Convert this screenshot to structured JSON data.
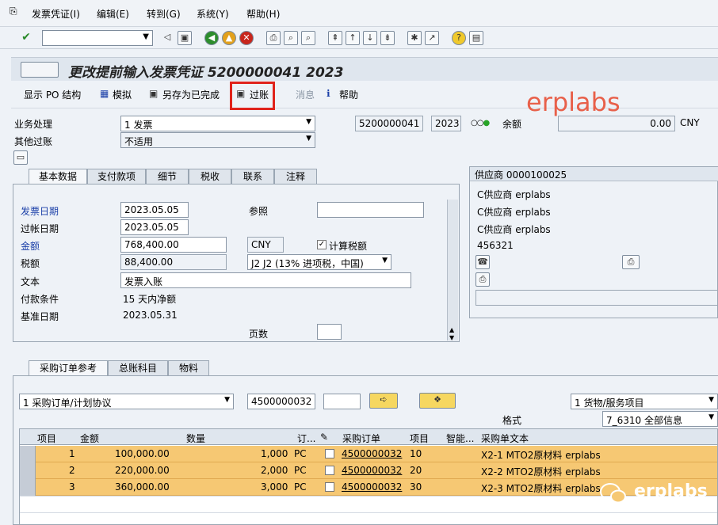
{
  "menu": {
    "items": [
      "发票凭证(I)",
      "编辑(E)",
      "转到(G)",
      "系统(Y)",
      "帮助(H)"
    ]
  },
  "title": "更改提前输入发票凭证 5200000041 2023",
  "appbar": {
    "show_po": "显示 PO 结构",
    "simulate": "模拟",
    "save_complete": "另存为已完成",
    "post": "过账",
    "messages": "消息",
    "help": "帮助"
  },
  "watermark": "erplabs",
  "header": {
    "txn_label": "业务处理",
    "txn_value": "1 发票",
    "other_label": "其他过账",
    "other_value": "不适用",
    "doc_no": "5200000041",
    "year": "2023",
    "balance_label": "余额",
    "balance_value": "0.00",
    "currency": "CNY"
  },
  "tabs": [
    "基本数据",
    "支付款项",
    "细节",
    "税收",
    "联系",
    "注释"
  ],
  "basic": {
    "invoice_date_label": "发票日期",
    "invoice_date": "2023.05.05",
    "reference_label": "参照",
    "reference": "",
    "posting_date_label": "过帐日期",
    "posting_date": "2023.05.05",
    "amount_label": "金额",
    "amount": "768,400.00",
    "amount_cur": "CNY",
    "calc_tax_label": "计算税额",
    "tax_label": "税额",
    "tax": "88,400.00",
    "tax_code": "J2 J2 (13% 进项税，中国)",
    "text_label": "文本",
    "text": "发票入账",
    "terms_label": "付款条件",
    "terms": "15 天内净额",
    "baseline_label": "基准日期",
    "baseline": "2023.05.31",
    "pages_label": "页数"
  },
  "vendor": {
    "title": "供应商 0000100025",
    "lines": [
      "C供应商 erplabs",
      "C供应商 erplabs",
      "C供应商 erplabs",
      "456321"
    ]
  },
  "tabs2": [
    "采购订单参考",
    "总账科目",
    "物料"
  ],
  "poref": {
    "type": "1 采购订单/计划协议",
    "po_no": "4500000032",
    "item_type": "1 货物/服务项目",
    "layout_label": "格式",
    "layout": "7_6310 全部信息"
  },
  "grid": {
    "headers": [
      "项目",
      "金额",
      "数量",
      "订...",
      "",
      "采购订单",
      "项目",
      "智能...",
      "采购单文本"
    ],
    "rows": [
      {
        "item": "1",
        "amount": "100,000.00",
        "qty": "1,000",
        "unit": "PC",
        "po": "4500000032",
        "po_item": "10",
        "text": "X2-1 MTO2原材料 erplabs"
      },
      {
        "item": "2",
        "amount": "220,000.00",
        "qty": "2,000",
        "unit": "PC",
        "po": "4500000032",
        "po_item": "20",
        "text": "X2-2 MTO2原材料 erplabs"
      },
      {
        "item": "3",
        "amount": "360,000.00",
        "qty": "3,000",
        "unit": "PC",
        "po": "4500000032",
        "po_item": "30",
        "text": "X2-3 MTO2原材料 erplabs"
      }
    ]
  },
  "footer_brand": "erplabs"
}
